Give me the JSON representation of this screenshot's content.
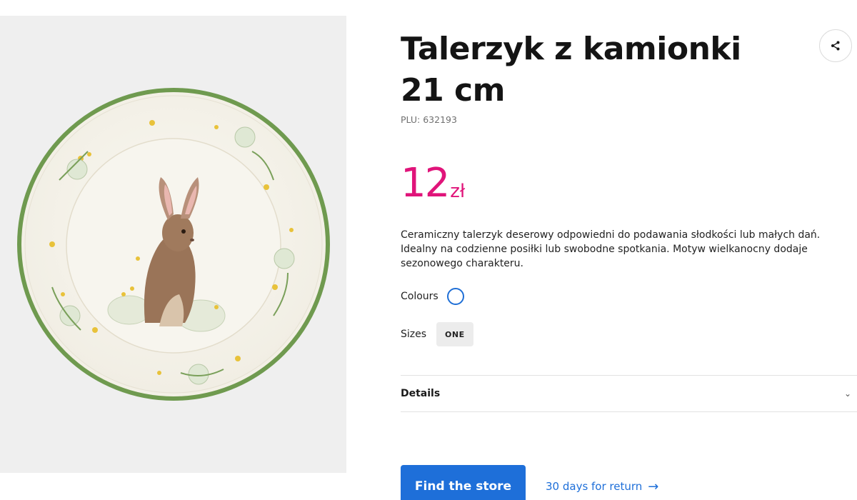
{
  "product": {
    "title": "Talerzyk z kamionki 21 cm",
    "plu": "PLU: 632193",
    "price_amount": "12",
    "price_currency": "zł",
    "description": "Ceramiczny talerzyk deserowy odpowiedni do podawania słodkości lub małych dań. Idealny na codzienne posiłki lub swobodne spotkania. Motyw wielkanocny dodaje sezonowego charakteru.",
    "image_alt": "plate-with-rabbit-image"
  },
  "options": {
    "colours_label": "Colours",
    "sizes_label": "Sizes",
    "size_value": "ONE"
  },
  "details": {
    "label": "Details",
    "chevron": "⌄"
  },
  "actions": {
    "find_store_label": "Find the store",
    "return_label": "30 days for return",
    "return_arrow": "→"
  },
  "icons": {
    "share": "share-icon"
  },
  "colors": {
    "price": "#e0147a",
    "accent": "#1e6fd9",
    "image_background": "#efefef",
    "plate_rim": "#6f9a4f"
  }
}
